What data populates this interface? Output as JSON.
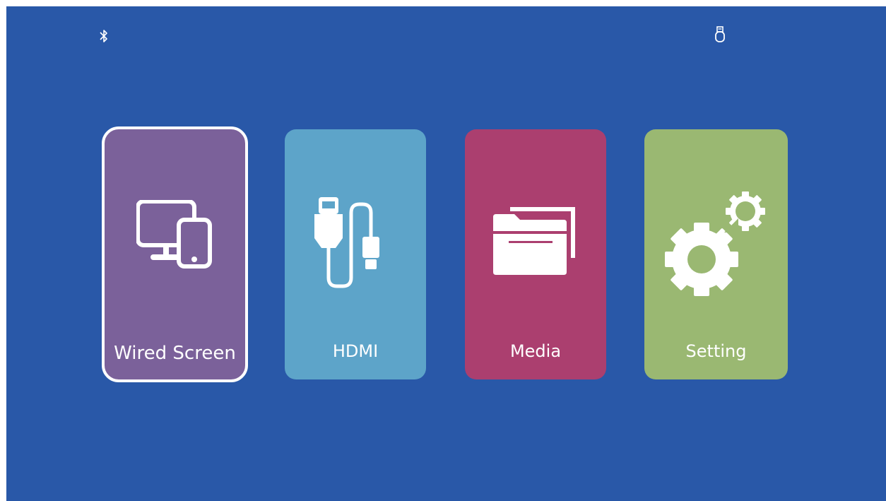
{
  "status_bar": {
    "left_icon": "bluetooth-icon",
    "right_icon": "usb-drive-icon"
  },
  "tiles": [
    {
      "label": "Wired Screen",
      "icon": "devices-icon",
      "color": "#7b619a",
      "selected": true
    },
    {
      "label": "HDMI",
      "icon": "hdmi-cable-icon",
      "color": "#5da4c9",
      "selected": false
    },
    {
      "label": "Media",
      "icon": "folder-icon",
      "color": "#ab3f6f",
      "selected": false
    },
    {
      "label": "Setting",
      "icon": "gears-icon",
      "color": "#9ab872",
      "selected": false
    }
  ],
  "colors": {
    "background": "#2958a8",
    "selection_border": "#ffffff"
  }
}
